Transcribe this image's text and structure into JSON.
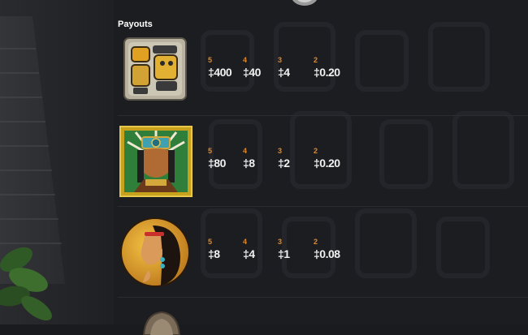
{
  "payouts": {
    "title": "Payouts",
    "rows": [
      {
        "symbol": "glyph-tablet-icon",
        "payouts": [
          {
            "count": "5",
            "amount": "‡400"
          },
          {
            "count": "4",
            "amount": "‡40"
          },
          {
            "count": "3",
            "amount": "‡4"
          },
          {
            "count": "2",
            "amount": "‡0.20"
          }
        ]
      },
      {
        "symbol": "aztec-chief-icon",
        "payouts": [
          {
            "count": "5",
            "amount": "‡80"
          },
          {
            "count": "4",
            "amount": "‡8"
          },
          {
            "count": "3",
            "amount": "‡2"
          },
          {
            "count": "2",
            "amount": "‡0.20"
          }
        ]
      },
      {
        "symbol": "aztec-woman-icon",
        "payouts": [
          {
            "count": "5",
            "amount": "‡8"
          },
          {
            "count": "4",
            "amount": "‡4"
          },
          {
            "count": "3",
            "amount": "‡1"
          },
          {
            "count": "2",
            "amount": "‡0.08"
          }
        ]
      }
    ]
  },
  "colors": {
    "count_label": "#e08a2a",
    "amount_text": "#f1f1f1",
    "panel_bg": "#1c1d21"
  }
}
